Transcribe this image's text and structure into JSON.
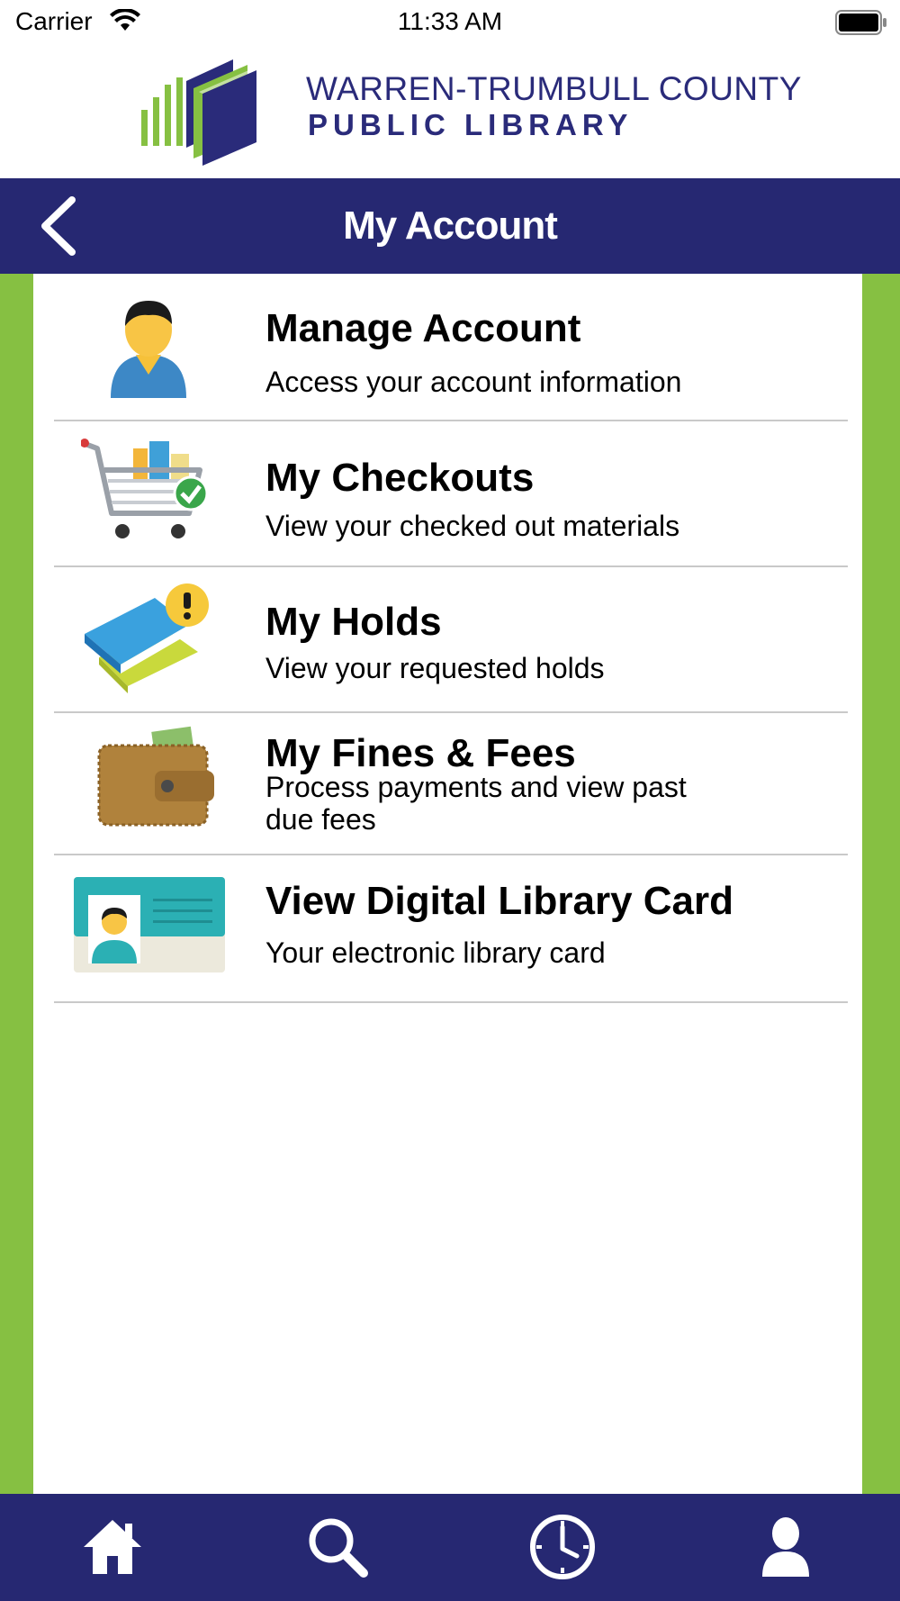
{
  "status_bar": {
    "carrier": "Carrier",
    "time": "11:33 AM"
  },
  "logo": {
    "line1": "WARREN-TRUMBULL COUNTY",
    "line2": "PUBLIC LIBRARY"
  },
  "navbar": {
    "title": "My Account"
  },
  "menu": [
    {
      "title": "Manage Account",
      "subtitle": "Access your account information",
      "icon": "user-icon"
    },
    {
      "title": "My Checkouts",
      "subtitle": "View your checked out materials",
      "icon": "shopping-cart-icon"
    },
    {
      "title": "My Holds",
      "subtitle": "View your requested holds",
      "icon": "books-alert-icon"
    },
    {
      "title": "My Fines & Fees",
      "subtitle": "Process payments and view past due fees",
      "icon": "wallet-icon"
    },
    {
      "title": "View Digital Library Card",
      "subtitle": "Your electronic library card",
      "icon": "library-card-icon"
    }
  ],
  "tabbar": [
    {
      "name": "home",
      "icon": "home-icon"
    },
    {
      "name": "search",
      "icon": "search-icon"
    },
    {
      "name": "history",
      "icon": "clock-icon"
    },
    {
      "name": "account",
      "icon": "person-icon"
    }
  ],
  "colors": {
    "navy": "#262872",
    "green": "#86c042",
    "divider": "#c9c9c9"
  }
}
